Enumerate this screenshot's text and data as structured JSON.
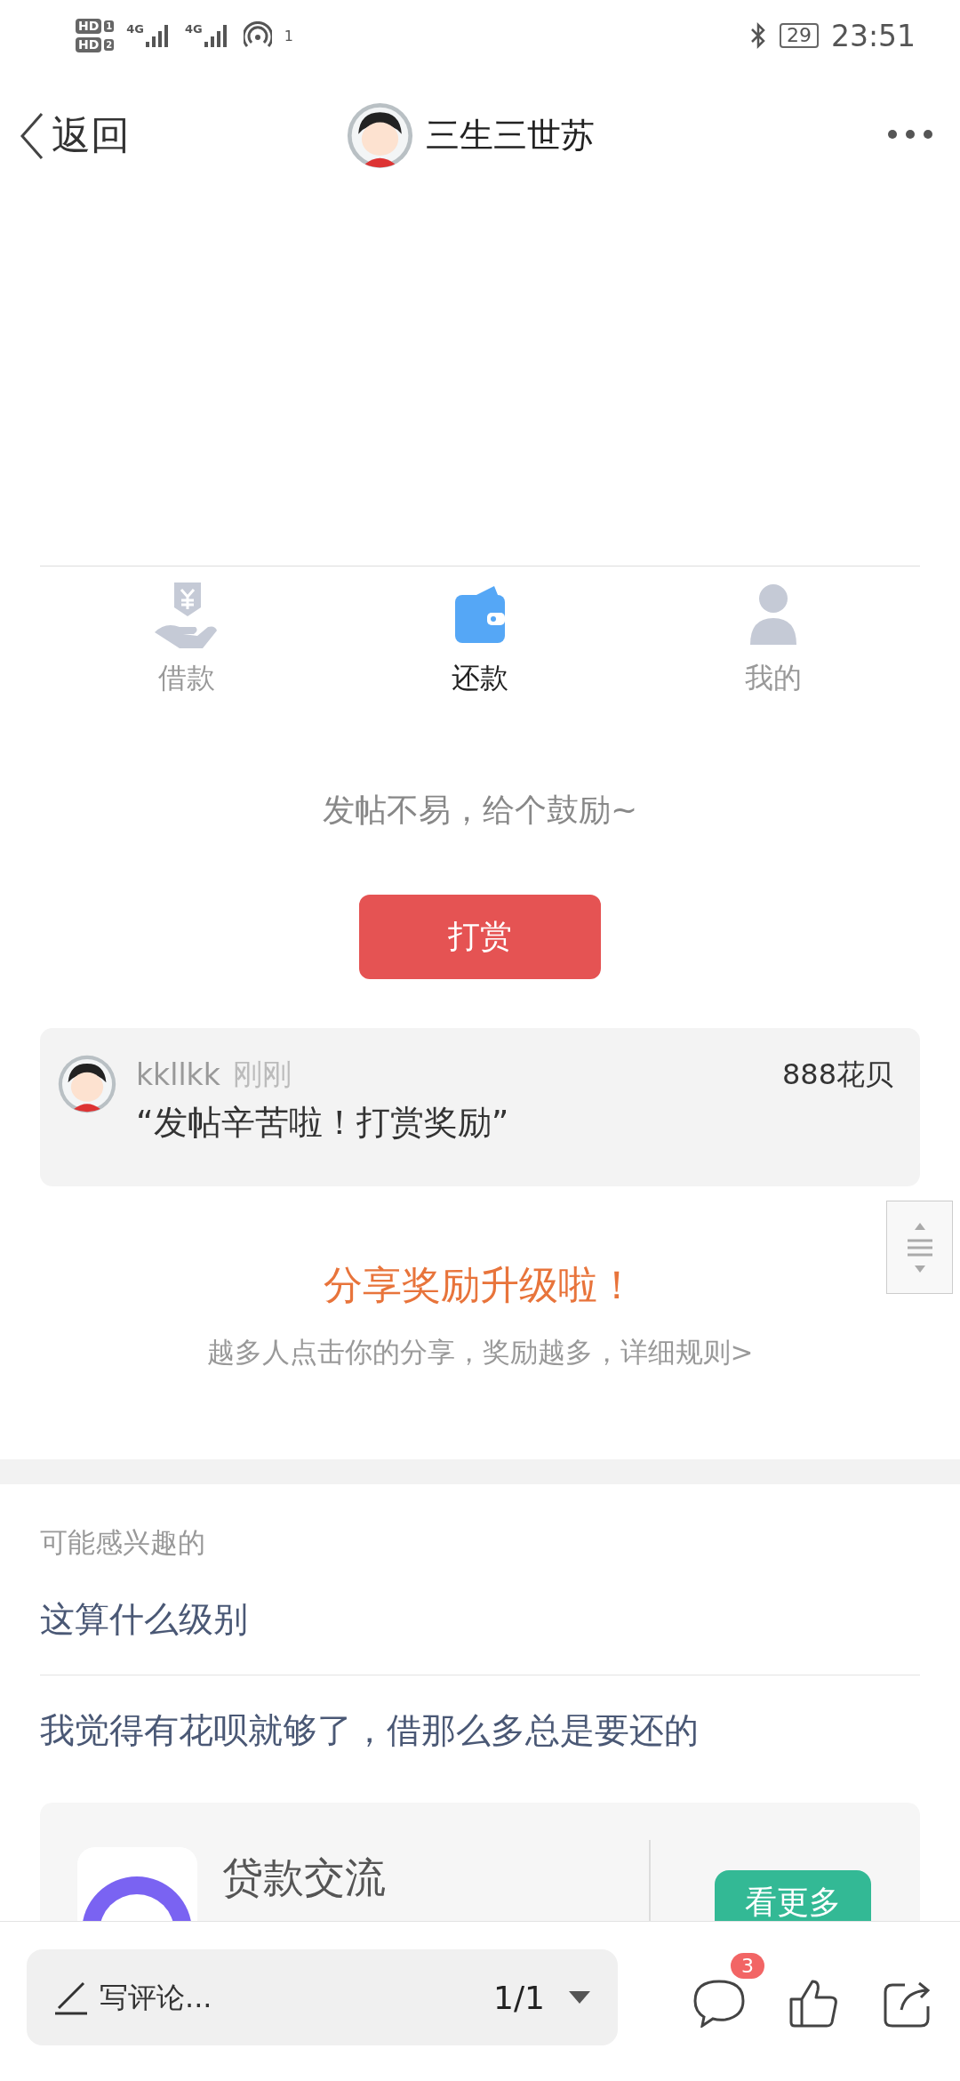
{
  "status_bar": {
    "sim_badges": [
      {
        "label": "HD",
        "slot": "1"
      },
      {
        "label": "HD",
        "slot": "2"
      }
    ],
    "networks": [
      "4G",
      "4G"
    ],
    "hotspot_count": "1",
    "battery": "29",
    "time": "23:51"
  },
  "header": {
    "back_label": "返回",
    "title": "三生三世苏"
  },
  "tabs": [
    {
      "label": "借款",
      "selected": false
    },
    {
      "label": "还款",
      "selected": true
    },
    {
      "label": "我的",
      "selected": false
    }
  ],
  "reward": {
    "prompt": "发帖不易，给个鼓励~",
    "button": "打赏"
  },
  "reward_comment": {
    "user": "kkllkk",
    "time": "刚刚",
    "amount": "888花贝",
    "message": "“发帖辛苦啦！打赏奖励”"
  },
  "share_promo": {
    "title": "分享奖励升级啦！",
    "subtitle": "越多人点击你的分享，奖励越多，详细规则>"
  },
  "related": {
    "heading": "可能感兴趣的",
    "items": [
      "这算什么级别",
      "我觉得有花呗就够了，借那么多总是要还的"
    ]
  },
  "group_card": {
    "name": "贷款交流",
    "button": "看更多"
  },
  "bottom_bar": {
    "placeholder": "写评论...",
    "page": "1/1",
    "comment_count": "3"
  }
}
